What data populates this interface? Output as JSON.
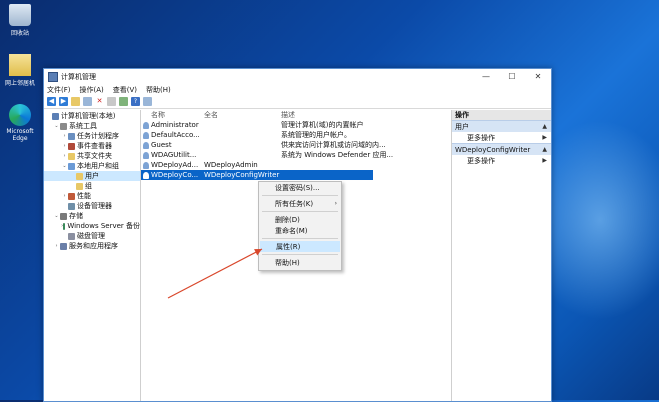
{
  "desktop": {
    "icons": [
      {
        "label": "回收站",
        "icon": "recycle-bin-icon"
      },
      {
        "label": "网上邻居机",
        "icon": "document-icon"
      },
      {
        "label": "Microsoft Edge",
        "icon": "edge-icon"
      }
    ]
  },
  "window": {
    "title": "计算机管理",
    "controls": {
      "minimize": "—",
      "maximize": "☐",
      "close": "✕"
    }
  },
  "menu": [
    "文件(F)",
    "操作(A)",
    "查看(V)",
    "帮助(H)"
  ],
  "tree": [
    {
      "label": "计算机管理(本地)",
      "indent": 0,
      "twisty": "",
      "icon": "computer-icon"
    },
    {
      "label": "系统工具",
      "indent": 1,
      "twisty": "v",
      "icon": "tools-icon"
    },
    {
      "label": "任务计划程序",
      "indent": 2,
      "twisty": ">",
      "icon": "clock-icon"
    },
    {
      "label": "事件查看器",
      "indent": 2,
      "twisty": ">",
      "icon": "event-viewer-icon"
    },
    {
      "label": "共享文件夹",
      "indent": 2,
      "twisty": ">",
      "icon": "folder-icon"
    },
    {
      "label": "本地用户和组",
      "indent": 2,
      "twisty": "v",
      "icon": "users-icon"
    },
    {
      "label": "用户",
      "indent": 3,
      "twisty": "",
      "icon": "folder-icon",
      "selected": true
    },
    {
      "label": "组",
      "indent": 3,
      "twisty": "",
      "icon": "folder-icon"
    },
    {
      "label": "性能",
      "indent": 2,
      "twisty": ">",
      "icon": "performance-icon"
    },
    {
      "label": "设备管理器",
      "indent": 2,
      "twisty": "",
      "icon": "device-manager-icon"
    },
    {
      "label": "存储",
      "indent": 1,
      "twisty": "v",
      "icon": "storage-icon"
    },
    {
      "label": "Windows Server 备份",
      "indent": 2,
      "twisty": ">",
      "icon": "backup-icon"
    },
    {
      "label": "磁盘管理",
      "indent": 2,
      "twisty": "",
      "icon": "disk-icon"
    },
    {
      "label": "服务和应用程序",
      "indent": 1,
      "twisty": ">",
      "icon": "services-icon"
    }
  ],
  "list": {
    "headers": {
      "name": "名称",
      "fullname": "全名",
      "desc": "描述"
    },
    "rows": [
      {
        "name": "Administrator",
        "fullname": "",
        "desc": "管理计算机(域)的内置帐户"
      },
      {
        "name": "DefaultAcco...",
        "fullname": "",
        "desc": "系统管理的用户帐户。"
      },
      {
        "name": "Guest",
        "fullname": "",
        "desc": "供来宾访问计算机或访问域的内..."
      },
      {
        "name": "WDAGUtilit...",
        "fullname": "",
        "desc": "系统为 Windows Defender 应用..."
      },
      {
        "name": "WDeployAd...",
        "fullname": "WDeployAdmin",
        "desc": ""
      },
      {
        "name": "WDeployCo...",
        "fullname": "WDeployConfigWriter",
        "desc": "",
        "highlighted": true
      }
    ]
  },
  "actions": {
    "title": "操作",
    "groups": [
      {
        "label": "用户",
        "item": "更多操作"
      },
      {
        "label": "WDeployConfigWriter",
        "item": "更多操作"
      }
    ]
  },
  "context_menu": [
    {
      "label": "设置密码(S)...",
      "submenu": false
    },
    {
      "sep": true
    },
    {
      "label": "所有任务(K)",
      "submenu": true
    },
    {
      "sep": true
    },
    {
      "label": "删除(D)",
      "submenu": false
    },
    {
      "label": "重命名(M)",
      "submenu": false
    },
    {
      "sep": true
    },
    {
      "label": "属性(R)",
      "submenu": false,
      "active": true
    },
    {
      "sep": true
    },
    {
      "label": "帮助(H)",
      "submenu": false
    }
  ],
  "colors": {
    "selection": "#0a64c8",
    "arrow": "#d9472b",
    "tree_selected": "#cce8ff"
  }
}
